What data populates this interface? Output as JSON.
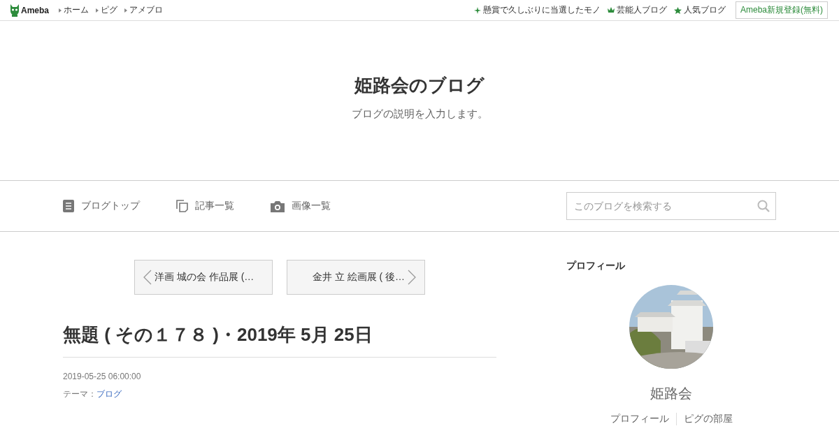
{
  "topbar": {
    "logo": "Ameba",
    "links": [
      "ホーム",
      "ピグ",
      "アメブロ"
    ],
    "right_links": [
      {
        "label": "懸賞で久しぶりに当選したモノ",
        "kind": "sparkle"
      },
      {
        "label": "芸能人ブログ",
        "kind": "crown"
      },
      {
        "label": "人気ブログ",
        "kind": "star"
      }
    ],
    "signup": "Ameba新規登録(無料)"
  },
  "header": {
    "title": "姫路会のブログ",
    "description": "ブログの説明を入力します。"
  },
  "nav": {
    "items": [
      {
        "label": "ブログトップ",
        "kind": "doc"
      },
      {
        "label": "記事一覧",
        "kind": "copy"
      },
      {
        "label": "画像一覧",
        "kind": "camera"
      }
    ],
    "search": {
      "placeholder": "このブログを検索する"
    }
  },
  "pager": {
    "prev": "洋画 城の会 作品展 (…",
    "next": "金井 立 絵画展 ( 後…"
  },
  "article": {
    "title": "無題 ( その１７８ )・2019年 5月 25日",
    "date": "2019-05-25 06:00:00",
    "theme_label": "テーマ：",
    "theme": "ブログ"
  },
  "profile": {
    "heading": "プロフィール",
    "avatar": {
      "kind": "picture"
    },
    "name": "姫路会",
    "links": [
      "プロフィール",
      "ピグの部屋"
    ]
  }
}
